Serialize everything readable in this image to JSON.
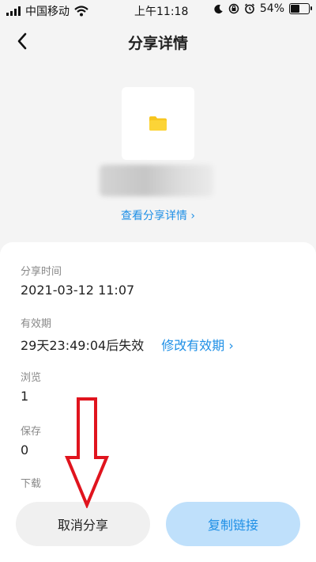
{
  "status_bar": {
    "carrier": "中国移动",
    "time": "上午11:18",
    "battery": "54%",
    "battery_level": 0.54,
    "icons": [
      "signal-icon",
      "wifi-icon",
      "moon-icon",
      "rotation-lock-icon",
      "alarm-icon",
      "battery-icon"
    ]
  },
  "nav": {
    "title": "分享详情",
    "back_icon": "chevron-left-icon"
  },
  "file": {
    "icon": "folder-icon",
    "folder_color": "#f7c61f"
  },
  "view_detail": "查看分享详情 ›",
  "details": {
    "share_time_label": "分享时间",
    "share_time_value": "2021-03-12 11:07",
    "validity_label": "有效期",
    "validity_value": "29天23:49:04后失效",
    "modify_validity": "修改有效期 ›",
    "views_label": "浏览",
    "views_value": "1",
    "saves_label": "保存",
    "saves_value": "0",
    "downloads_label": "下载"
  },
  "buttons": {
    "cancel_share": "取消分享",
    "copy_link": "复制链接"
  },
  "colors": {
    "accent": "#1e8fe6",
    "annotation_arrow": "#e0141e"
  }
}
